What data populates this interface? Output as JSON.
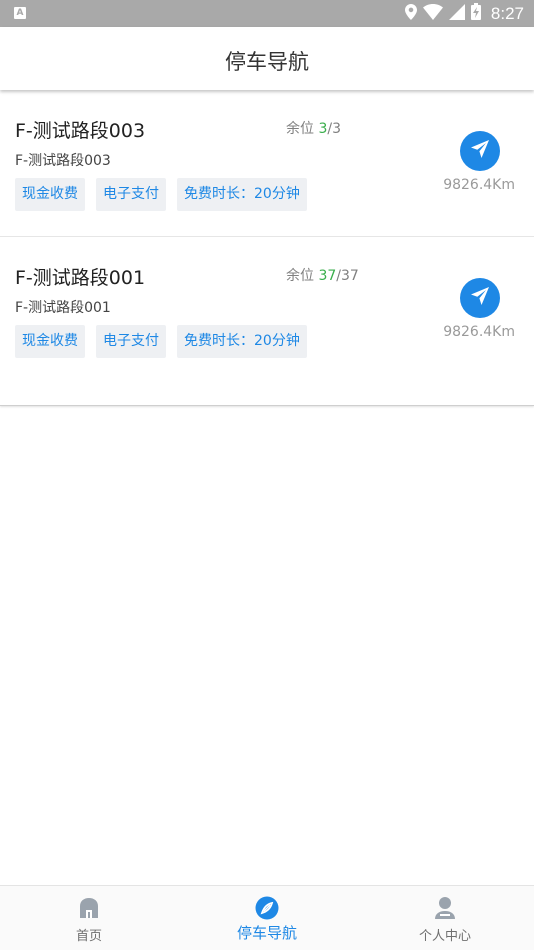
{
  "status_bar": {
    "badge": "A",
    "time": "8:27"
  },
  "header": {
    "title": "停车导航"
  },
  "parking_lots": [
    {
      "name": "F-测试路段003",
      "available_label": "余位",
      "available_free": "3",
      "available_total": "/3",
      "address": "F-测试路段003",
      "tags": [
        "现金收费",
        "电子支付",
        "免费时长：20分钟"
      ],
      "distance": "9826.4Km"
    },
    {
      "name": "F-测试路段001",
      "available_label": "余位",
      "available_free": "37",
      "available_total": "/37",
      "address": "F-测试路段001",
      "tags": [
        "现金收费",
        "电子支付",
        "免费时长：20分钟"
      ],
      "distance": "9826.4Km"
    }
  ],
  "tabbar": {
    "tabs": [
      {
        "label": "首页",
        "icon": "home-icon",
        "active": false
      },
      {
        "label": "停车导航",
        "icon": "compass-icon",
        "active": true
      },
      {
        "label": "个人中心",
        "icon": "person-icon",
        "active": false
      }
    ]
  },
  "colors": {
    "accent": "#1e88e5",
    "available": "#3aae4c",
    "status_bar": "#a9a9a9"
  }
}
